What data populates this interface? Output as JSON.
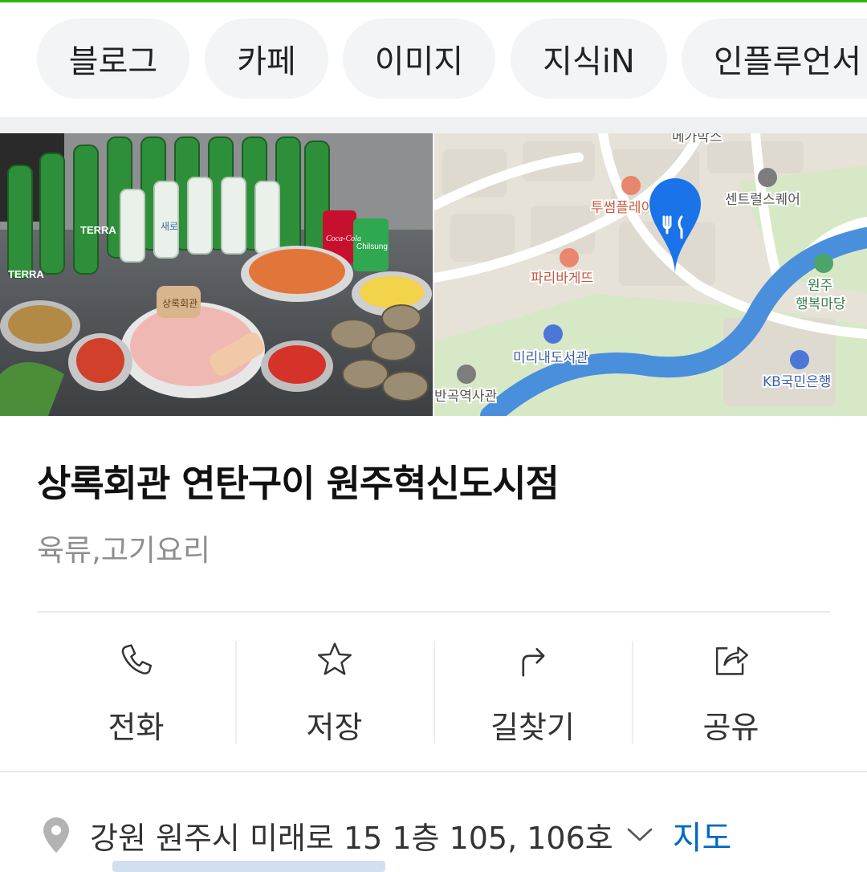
{
  "tabs": [
    "블로그",
    "카페",
    "이미지",
    "지식iN",
    "인플루언서"
  ],
  "photo": {
    "beer_brand": "TERRA",
    "soju_label": "새로",
    "plate_text": "상록회관",
    "cola_label": "Coca-Cola",
    "cider_label": "Chilsung"
  },
  "map": {
    "labels": {
      "top_cut": "메가박스",
      "twosome": "투썸플레이스",
      "central": "센트럴스퀘어",
      "paris": "파리바게뜨",
      "park": "원주",
      "park2": "행복마당",
      "library": "미리내도서관",
      "kb": "KB국민은행",
      "museum": "반곡역사관"
    },
    "colors": {
      "water": "#3d84d6",
      "park": "#d5e8c4",
      "block": "#e3dfd3",
      "road": "#ffffff",
      "pin": "#1a73e8"
    }
  },
  "place": {
    "name": "상록회관 연탄구이 원주혁신도시점",
    "category": "육류,고기요리"
  },
  "actions": [
    {
      "label": "전화",
      "icon": "phone-icon"
    },
    {
      "label": "저장",
      "icon": "star-icon"
    },
    {
      "label": "길찾기",
      "icon": "directions-icon"
    },
    {
      "label": "공유",
      "icon": "share-icon"
    }
  ],
  "address": {
    "text": "강원 원주시 미래로 15 1층 105, 106호",
    "map_link": "지도"
  },
  "colors": {
    "accent_green": "#2db400",
    "link_blue": "#0068c3",
    "pin_gray": "#b3b3b3"
  }
}
